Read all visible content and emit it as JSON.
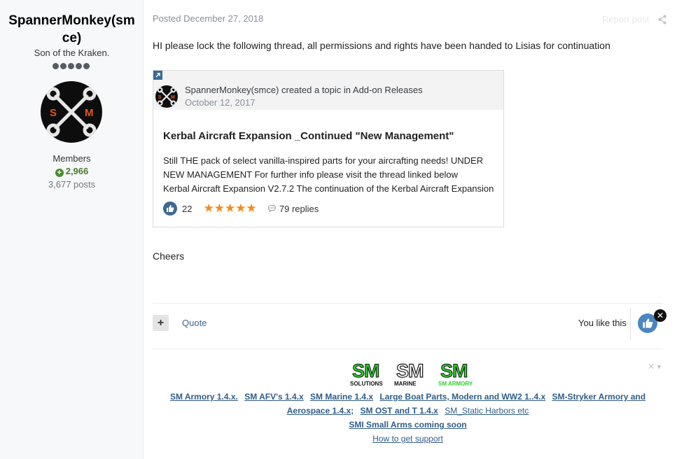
{
  "author": {
    "name": "SpannerMonkey(smce)",
    "title": "Son of the Kraken.",
    "group": "Members",
    "reputation": "2,966",
    "posts": "3,677 posts",
    "rank_pips": 5
  },
  "post": {
    "posted": "Posted December 27, 2018",
    "report_label": "Report post",
    "message": "HI please lock the following thread, all permissions and rights have been handed to Lisias for continuation",
    "closing": "Cheers"
  },
  "embed": {
    "meta": "SpannerMonkey(smce) created a topic in Add-on Releases",
    "date": "October 12, 2017",
    "title": "Kerbal Aircraft Expansion _Continued \"New Management\"",
    "snippet": [
      "Still THE pack of select vanilla-inspired parts for your aircrafting needs! UNDER",
      "NEW MANAGEMENT      For further info please visit the thread linked below",
      "Kerbal Aircraft Expansion V2.7.2   The continuation of the Kerbal Aircraft Expansion"
    ],
    "likes": "22",
    "stars": "★★★★★",
    "replies": "79 replies"
  },
  "controls": {
    "plus_label": "+",
    "quote_label": "Quote",
    "you_like": "You like this"
  },
  "signature": {
    "logos": [
      {
        "big": "SM",
        "small": "SOLUTIONS",
        "color": "#2bd12b"
      },
      {
        "big": "SM",
        "small": "MARINE",
        "color": "#ffffff"
      },
      {
        "big": "SM",
        "small": "SM ARMORY",
        "color": "#2bd12b"
      }
    ],
    "links": {
      "armory": "SM Armory 1.4.x.",
      "afv": "SM AFV's 1.4.x",
      "marine": "SM Marine 1.4.x",
      "boat": "Large Boat Parts, Modern and WW2 1..4.x",
      "stryker": "SM-Stryker Armory and",
      "aerospace": "Aerospace 1.4.x;",
      "ost": "SM OST and T 1.4.x",
      "harbors": "SM_Static Harbors etc",
      "small_arms": "SMI Small Arms coming soon",
      "support": "How to get support"
    }
  },
  "colors": {
    "accent": "#3c6994",
    "reputation": "#4a7a2b",
    "star": "#f58a1f"
  }
}
